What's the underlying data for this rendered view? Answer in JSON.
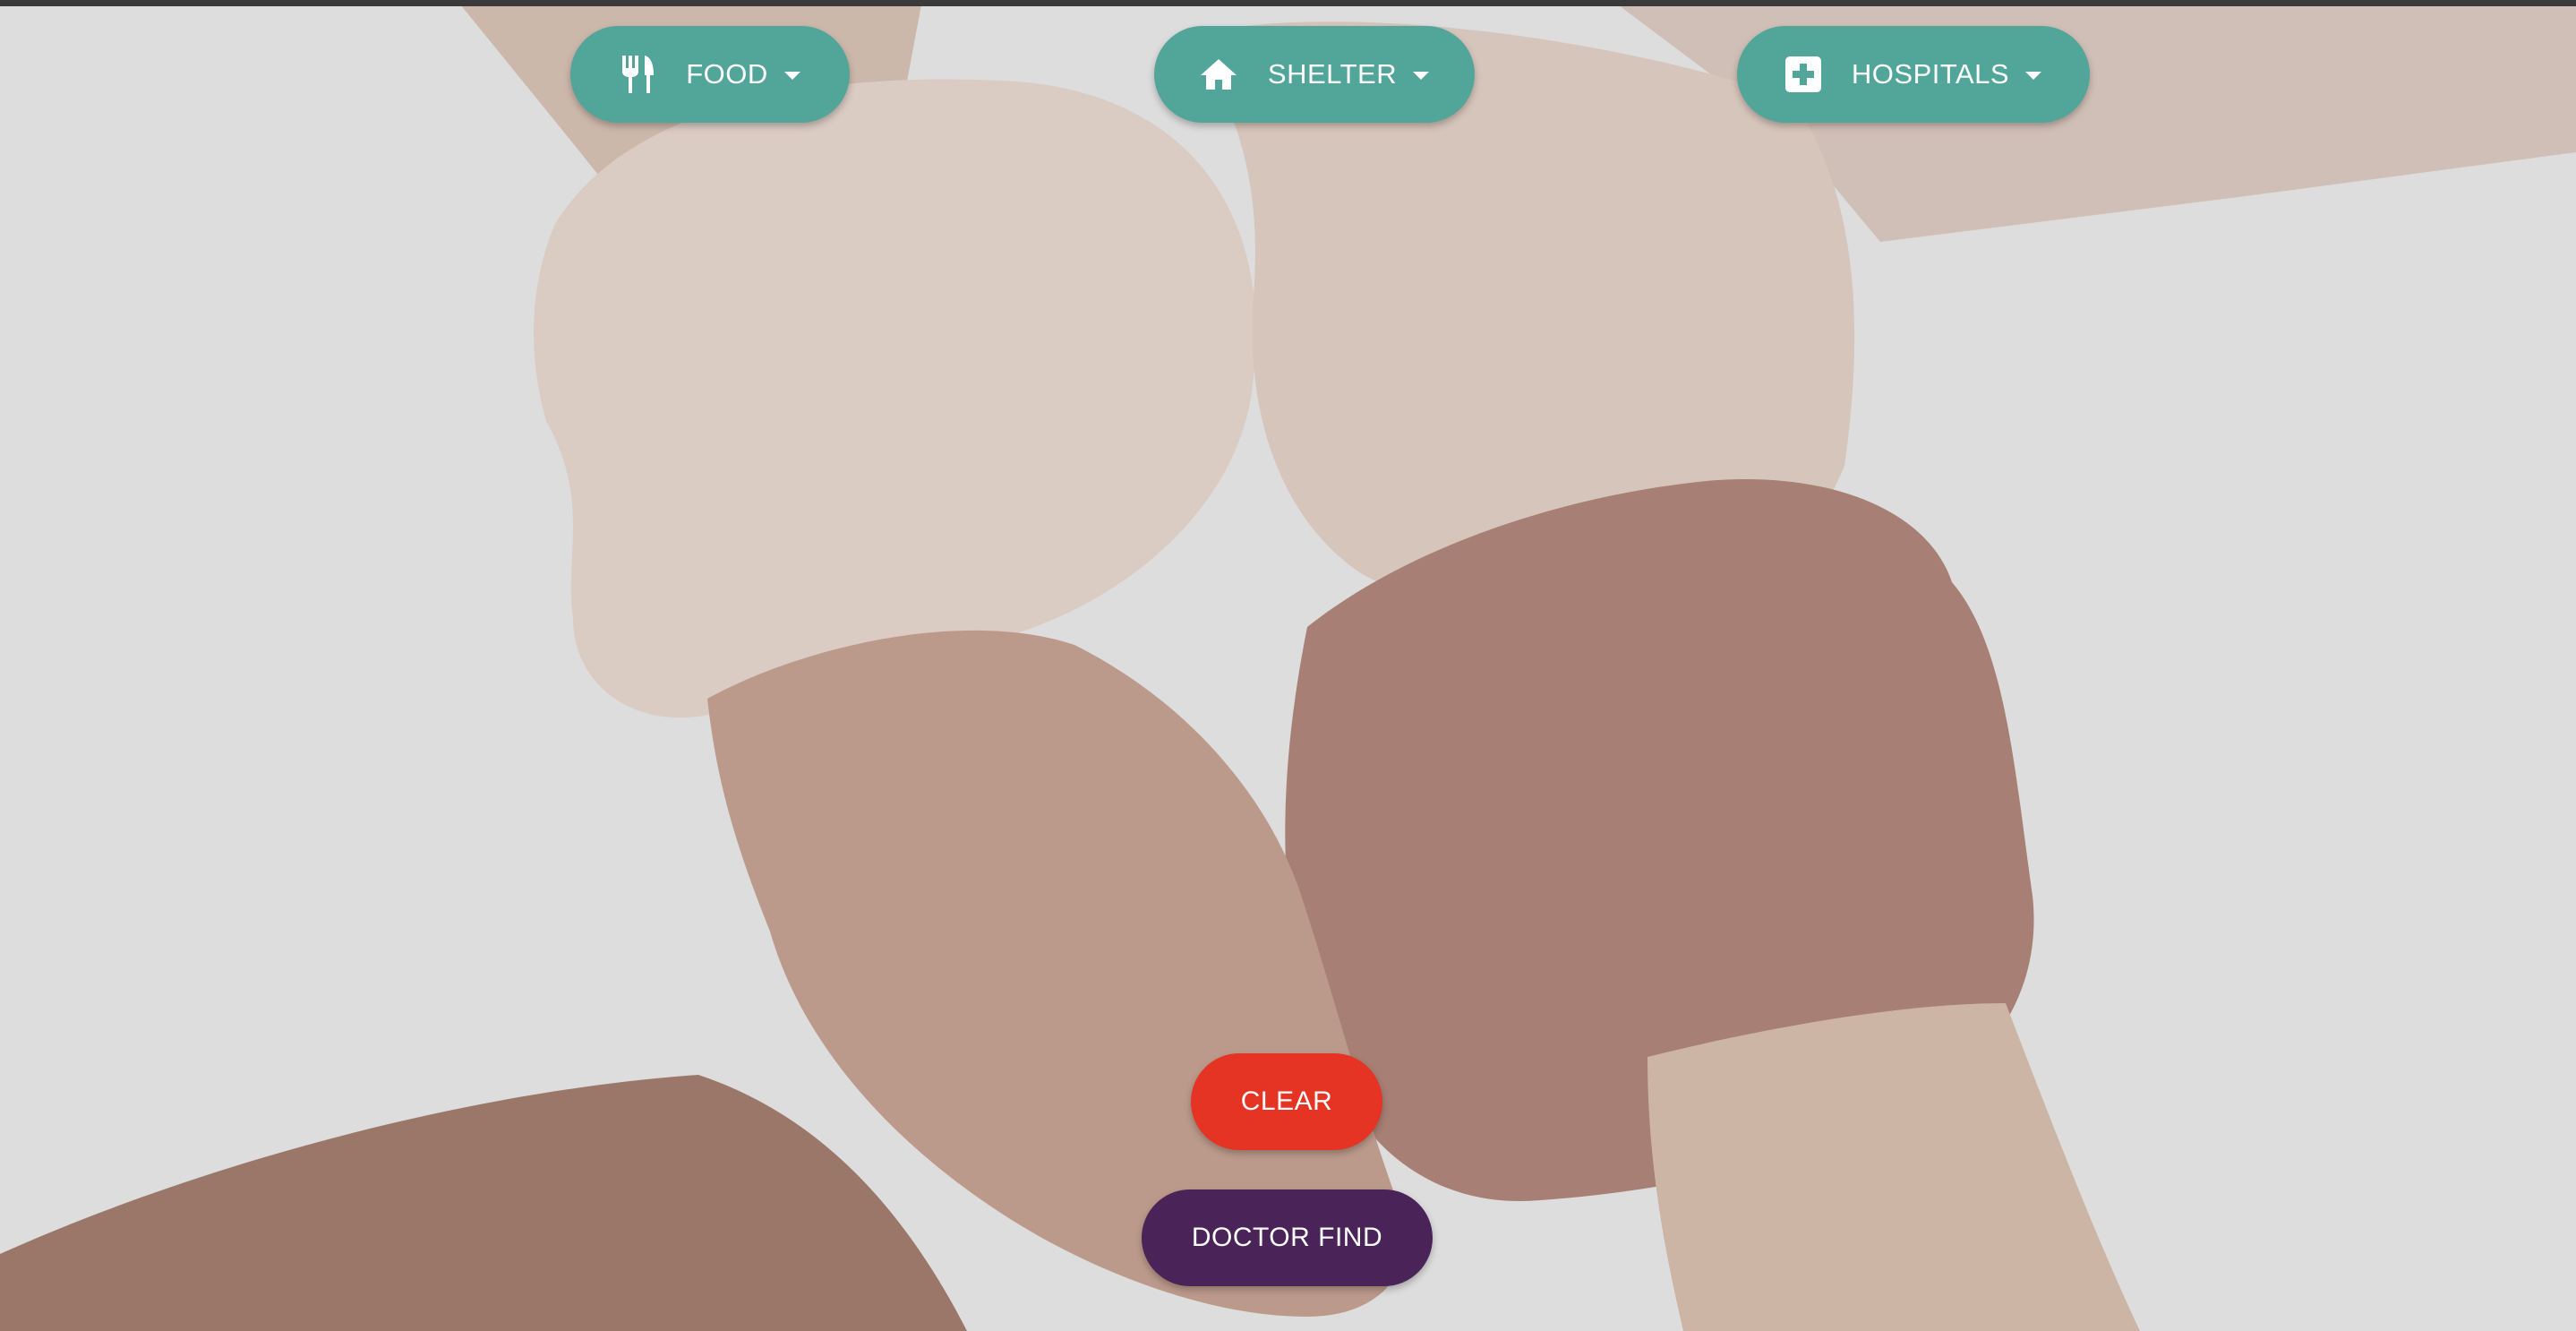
{
  "toolbar": {
    "food_label": "FOOD",
    "shelter_label": "SHELTER",
    "hospitals_label": "HOSPITALS",
    "food_icon": "fork-knife-icon",
    "shelter_icon": "home-icon",
    "hospitals_icon": "medical-cross-icon"
  },
  "actions": {
    "clear_label": "CLEAR",
    "doctor_find_label": "DOCTOR FIND"
  },
  "background": {
    "image_subject": "four-hands-interlocked-wrists"
  },
  "colors": {
    "teal": "#52a599",
    "clear_red": "#e53324",
    "doctor_purple": "#4a2358",
    "background": "#dcdcdc"
  }
}
